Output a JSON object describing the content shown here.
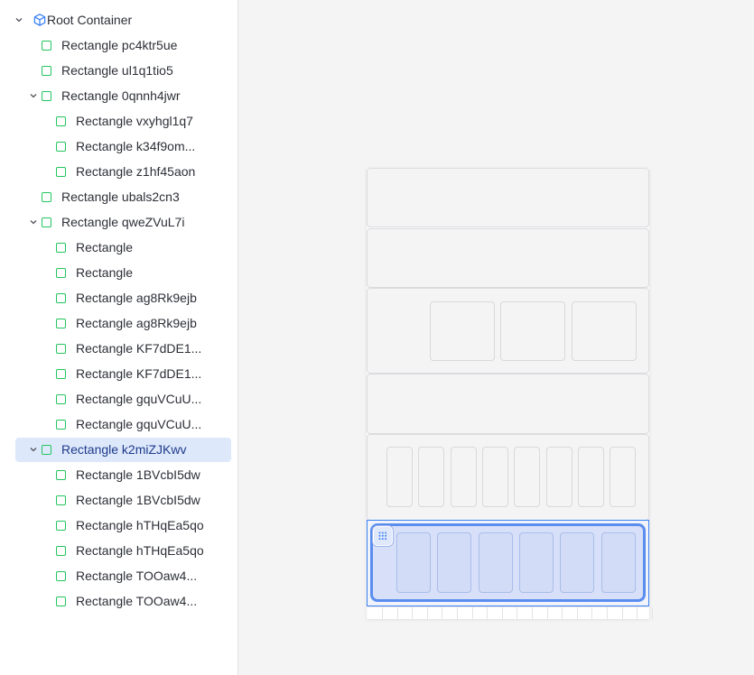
{
  "tree": {
    "items": [
      {
        "label": "Root Container",
        "type": "root",
        "depth": 0,
        "expanded": true
      },
      {
        "label": "Rectangle pc4ktr5ue",
        "type": "rect",
        "depth": 1
      },
      {
        "label": "Rectangle ul1q1tio5",
        "type": "rect",
        "depth": 1
      },
      {
        "label": "Rectangle 0qnnh4jwr",
        "type": "rect",
        "depth": 1,
        "expanded": true
      },
      {
        "label": "Rectangle vxyhgl1q7",
        "type": "rect",
        "depth": 2
      },
      {
        "label": "Rectangle k34f9om...",
        "type": "rect",
        "depth": 2
      },
      {
        "label": "Rectangle z1hf45aon",
        "type": "rect",
        "depth": 2
      },
      {
        "label": "Rectangle ubals2cn3",
        "type": "rect",
        "depth": 1
      },
      {
        "label": "Rectangle qweZVuL7i",
        "type": "rect",
        "depth": 1,
        "expanded": true
      },
      {
        "label": "Rectangle",
        "type": "rect",
        "depth": 2
      },
      {
        "label": "Rectangle",
        "type": "rect",
        "depth": 2
      },
      {
        "label": "Rectangle ag8Rk9ejb",
        "type": "rect",
        "depth": 2
      },
      {
        "label": "Rectangle ag8Rk9ejb",
        "type": "rect",
        "depth": 2
      },
      {
        "label": "Rectangle KF7dDE1...",
        "type": "rect",
        "depth": 2
      },
      {
        "label": "Rectangle KF7dDE1...",
        "type": "rect",
        "depth": 2
      },
      {
        "label": "Rectangle gquVCuU...",
        "type": "rect",
        "depth": 2
      },
      {
        "label": "Rectangle gquVCuU...",
        "type": "rect",
        "depth": 2
      },
      {
        "label": "Rectangle k2miZJKwv",
        "type": "rect",
        "depth": 1,
        "expanded": true,
        "selected": true
      },
      {
        "label": "Rectangle 1BVcbI5dw",
        "type": "rect",
        "depth": 2
      },
      {
        "label": "Rectangle 1BVcbI5dw",
        "type": "rect",
        "depth": 2
      },
      {
        "label": "Rectangle hTHqEa5qo",
        "type": "rect",
        "depth": 2
      },
      {
        "label": "Rectangle hTHqEa5qo",
        "type": "rect",
        "depth": 2
      },
      {
        "label": "Rectangle TOOaw4...",
        "type": "rect",
        "depth": 2
      },
      {
        "label": "Rectangle TOOaw4...",
        "type": "rect",
        "depth": 2
      }
    ]
  },
  "colors": {
    "accent": "#3b82f6",
    "rect_icon": "#22c55e",
    "root_icon": "#3b82f6",
    "selected_row": "#dde8fb"
  },
  "icons": {
    "chevron": "chevron-down-icon",
    "root": "cube-icon",
    "rectangle": "rectangle-icon",
    "handle": "grid-handle-icon"
  }
}
